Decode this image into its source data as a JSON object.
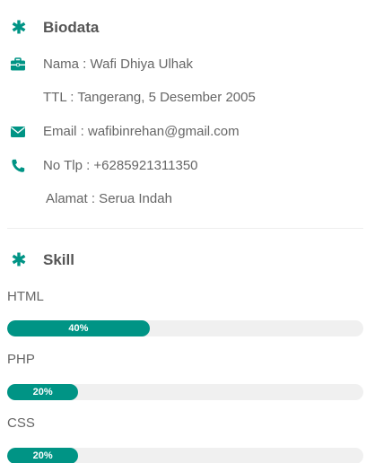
{
  "accent_color": "#009485",
  "biodata": {
    "title": "Biodata",
    "title_icon": "asterisk-icon",
    "rows": [
      {
        "icon": "briefcase-icon",
        "text": "Nama : Wafi Dhiya Ulhak"
      },
      {
        "icon": "",
        "text": "TTL : Tangerang, 5 Desember 2005"
      },
      {
        "icon": "envelope-icon",
        "text": "Email : wafibinrehan@gmail.com"
      },
      {
        "icon": "phone-icon",
        "text": "No Tlp : +6285921311350"
      },
      {
        "icon": "",
        "text": "Alamat : Serua Indah"
      }
    ]
  },
  "skill": {
    "title": "Skill",
    "title_icon": "asterisk-icon",
    "items": [
      {
        "name": "HTML",
        "percent": 40,
        "percent_label": "40%"
      },
      {
        "name": "PHP",
        "percent": 20,
        "percent_label": "20%"
      },
      {
        "name": "CSS",
        "percent": 20,
        "percent_label": "20%"
      }
    ]
  }
}
